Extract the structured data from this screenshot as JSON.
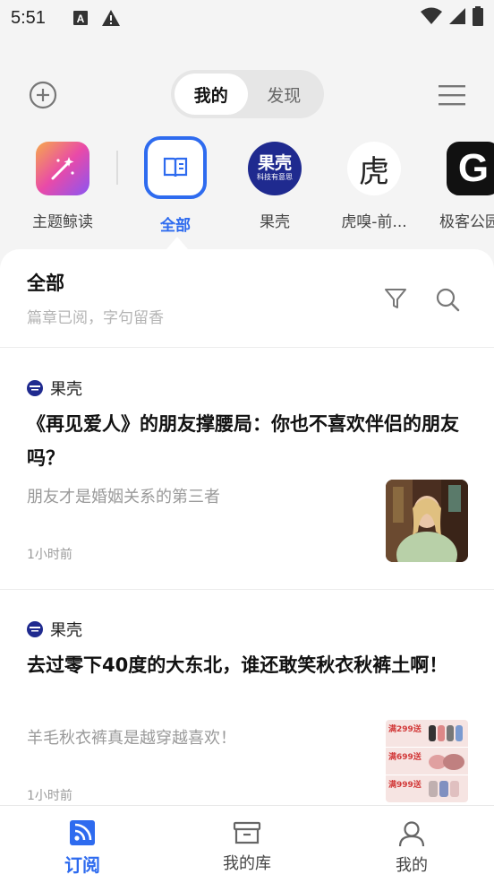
{
  "status_bar": {
    "time": "5:51",
    "icons": [
      "keyboard-icon",
      "warning-icon",
      "wifi-icon",
      "signal-icon",
      "battery-icon"
    ]
  },
  "top_nav": {
    "segments": [
      {
        "label": "我的",
        "active": true
      },
      {
        "label": "发现",
        "active": false
      }
    ]
  },
  "sources": [
    {
      "label": "主题鲸读",
      "icon": "magic-wand-icon",
      "active": false
    },
    {
      "label": "全部",
      "icon": "book-icon",
      "active": true
    },
    {
      "label": "果壳",
      "icon": "guokr-logo",
      "active": false,
      "logo_text": "果壳",
      "logo_subtext": "科技有意思"
    },
    {
      "label": "虎嗅-前...",
      "icon": "huxiu-logo",
      "active": false,
      "logo_text": "虎"
    },
    {
      "label": "极客公园",
      "icon": "geekpark-logo",
      "active": false,
      "logo_text": "G"
    }
  ],
  "main": {
    "title": "全部",
    "subtitle": "篇章已阅，字句留香"
  },
  "articles": [
    {
      "source": "果壳",
      "title": "《再见爱人》的朋友撑腰局：你也不喜欢伴侣的朋友吗？",
      "summary": "朋友才是婚姻关系的第三者",
      "time": "1小时前"
    },
    {
      "source": "果壳",
      "title": "去过零下40度的大东北，谁还敢笑秋衣秋裤土啊！",
      "summary": "羊毛秋衣裤真是越穿越喜欢！",
      "time": "1小时前",
      "thumb_texts": [
        "满299送",
        "满699送",
        "满999送"
      ]
    }
  ],
  "bottom_nav": [
    {
      "label": "订阅",
      "icon": "rss-icon",
      "active": true
    },
    {
      "label": "我的库",
      "icon": "archive-box-icon",
      "active": false
    },
    {
      "label": "我的",
      "icon": "user-icon",
      "active": false
    }
  ],
  "colors": {
    "accent": "#2e6bef",
    "guokr_blue": "#1f2a8f",
    "background": "#f4f4f4"
  }
}
